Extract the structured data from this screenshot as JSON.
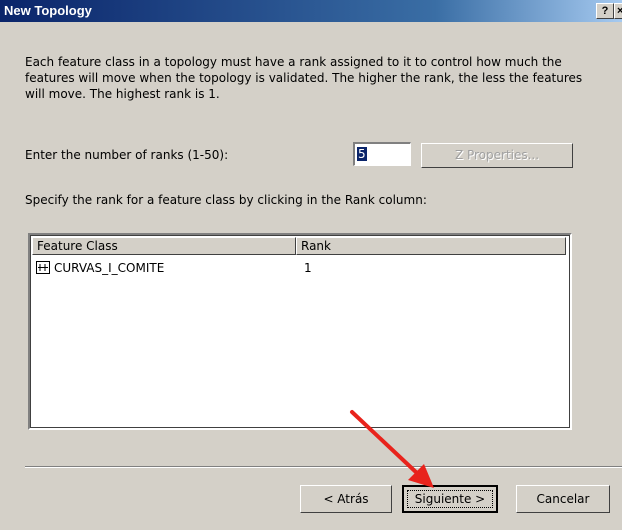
{
  "window": {
    "title": "New Topology",
    "help_btn": "?",
    "close_btn": "×"
  },
  "description": "Each feature class in a topology must have a rank assigned to it to control how much the features will move when the topology is validated. The higher the rank, the less the features will move. The highest rank is 1.",
  "ranks": {
    "label": "Enter the number of ranks  (1-50):",
    "value": "5",
    "z_properties_label": "Z Properties..."
  },
  "specify_label": "Specify the rank for a feature class by clicking in the Rank column:",
  "list": {
    "columns": [
      "Feature Class",
      "Rank"
    ],
    "rows": [
      {
        "icon": "line-feature-icon",
        "feature_class": "CURVAS_I_COMITE",
        "rank": "1"
      }
    ]
  },
  "buttons": {
    "back": "< Atrás",
    "next": "Siguiente >",
    "cancel": "Cancelar"
  },
  "annotation": {
    "arrow_color": "#e8231c"
  }
}
